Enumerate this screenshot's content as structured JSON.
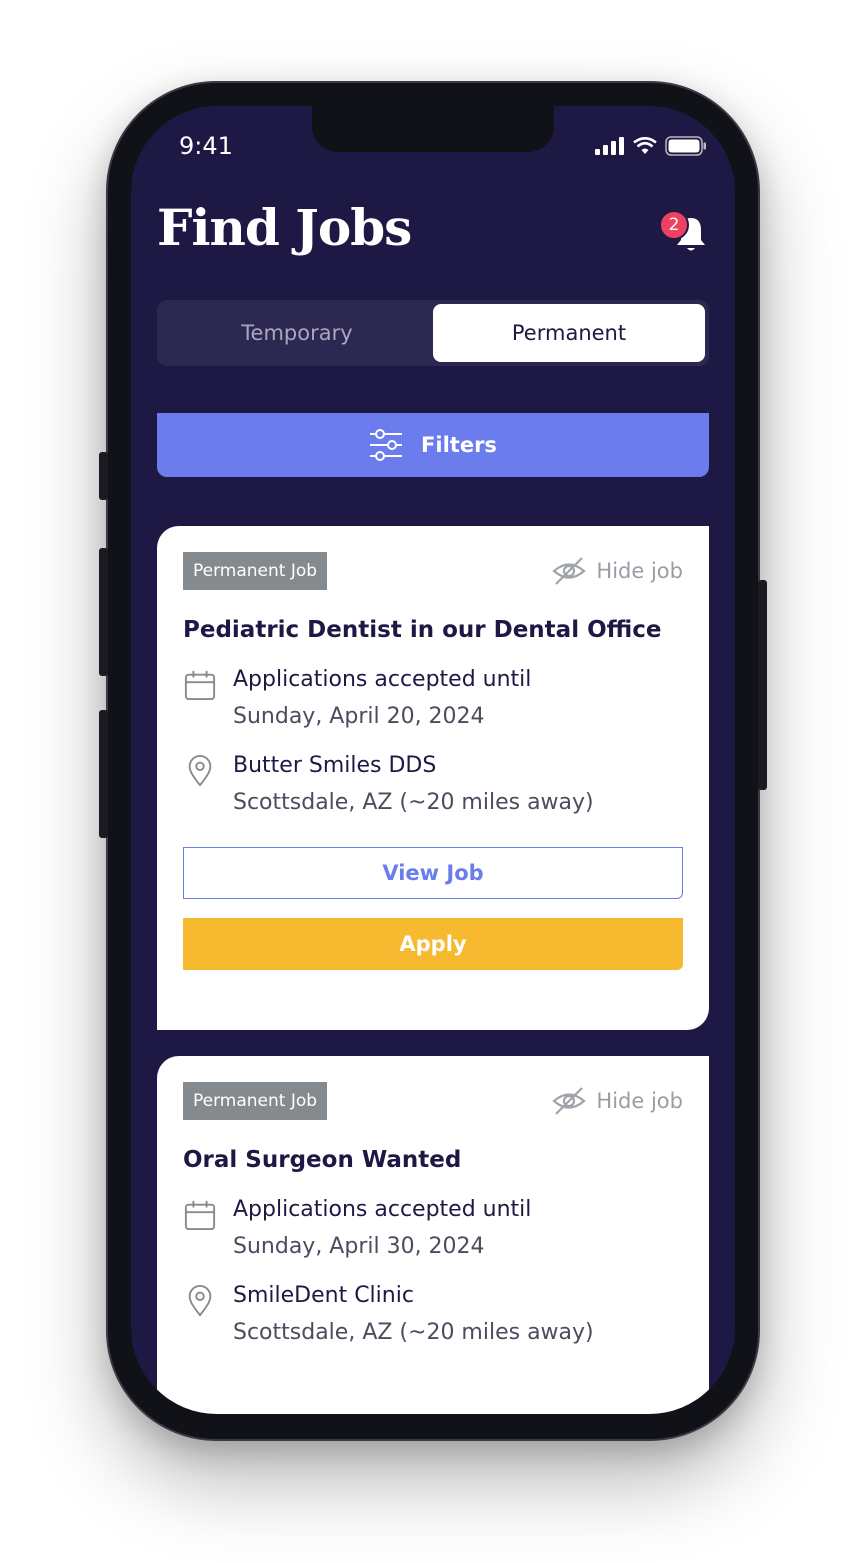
{
  "status_bar": {
    "time": "9:41"
  },
  "header": {
    "title": "Find Jobs",
    "notification_count": "2"
  },
  "tabs": [
    {
      "label": "Temporary",
      "active": false
    },
    {
      "label": "Permanent",
      "active": true
    }
  ],
  "filters": {
    "label": "Filters"
  },
  "jobs": [
    {
      "tag": "Permanent Job",
      "hide_label": "Hide job",
      "title": "Pediatric Dentist in our Dental Office",
      "date_label": "Applications accepted until",
      "date": "Sunday, April 20, 2024",
      "office": "Butter Smiles DDS",
      "location": "Scottsdale, AZ (~20 miles away)",
      "view_label": "View Job",
      "apply_label": "Apply"
    },
    {
      "tag": "Permanent Job",
      "hide_label": "Hide job",
      "title": "Oral Surgeon Wanted",
      "date_label": "Applications accepted until",
      "date": "Sunday, April 30, 2024",
      "office": "SmileDent Clinic",
      "location": "Scottsdale, AZ (~20 miles away)"
    }
  ],
  "colors": {
    "background": "#1e1944",
    "accent": "#6b7dec",
    "apply": "#f6b92f",
    "badge": "#f0405f",
    "tag": "#858a8f"
  }
}
